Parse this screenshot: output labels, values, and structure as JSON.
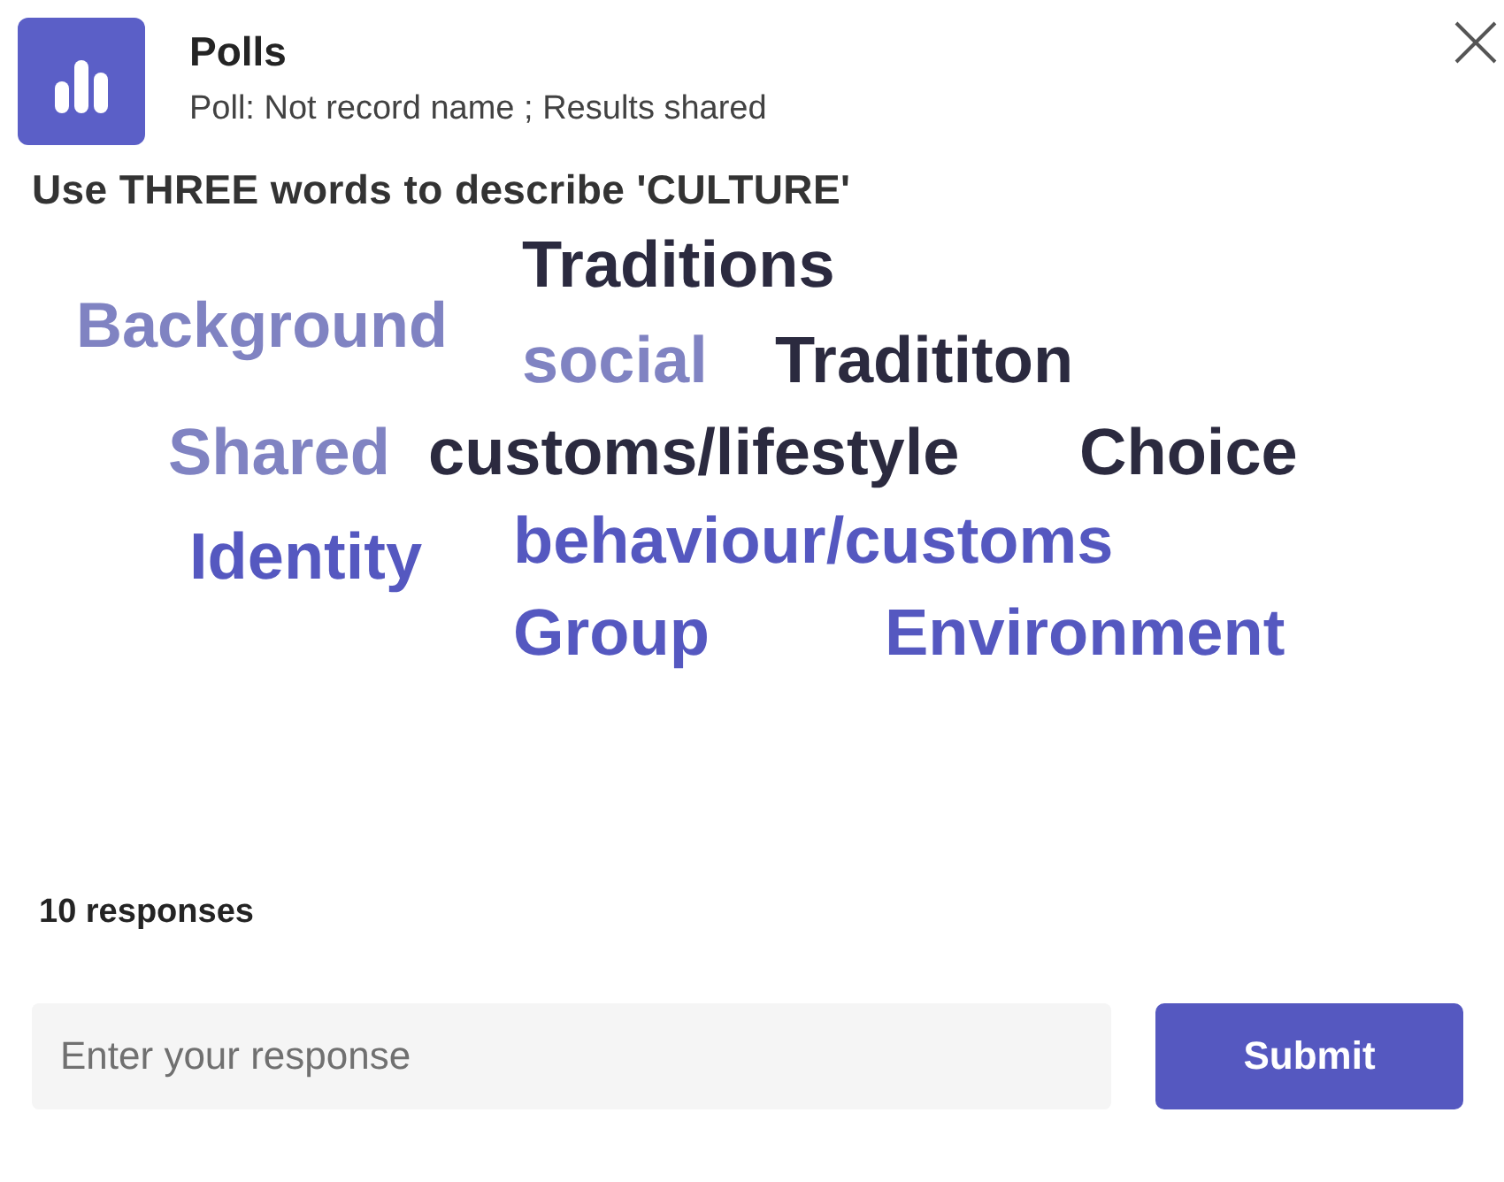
{
  "header": {
    "title": "Polls",
    "subtitle": "Poll: Not record name ; Results shared"
  },
  "question": "Use THREE words to describe 'CULTURE'",
  "word_cloud": [
    {
      "word": "Traditions",
      "color": "#2b2a3f"
    },
    {
      "word": "Background",
      "color": "#8083c2"
    },
    {
      "word": "social",
      "color": "#8083c2"
    },
    {
      "word": "Tradititon",
      "color": "#2b2a3f"
    },
    {
      "word": "Shared",
      "color": "#8083c2"
    },
    {
      "word": "customs/lifestyle",
      "color": "#2b2a3f"
    },
    {
      "word": "Choice",
      "color": "#2b2a3f"
    },
    {
      "word": "Identity",
      "color": "#5558c0"
    },
    {
      "word": "behaviour/customs",
      "color": "#5558c0"
    },
    {
      "word": "Group",
      "color": "#5558c0"
    },
    {
      "word": "Environment",
      "color": "#5558c0"
    }
  ],
  "responses": "10 responses",
  "response_field": {
    "placeholder": "Enter your response"
  },
  "submit_button": "Submit"
}
